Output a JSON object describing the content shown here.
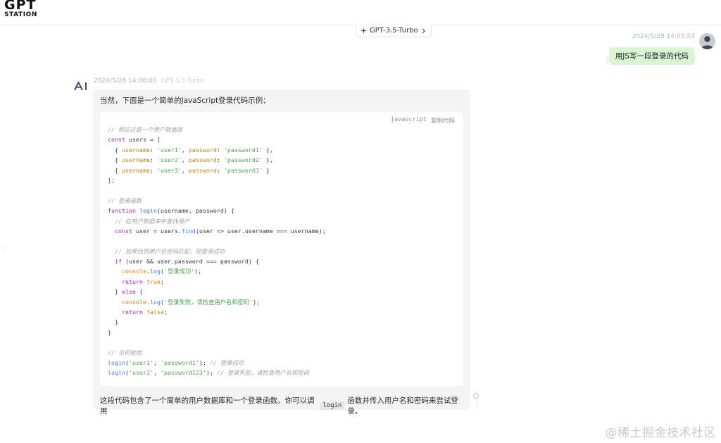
{
  "header": {
    "logo_line1": "GPT",
    "logo_line2": "STATION",
    "model_pill_label": "GPT-3.5-Turbo"
  },
  "user_message": {
    "timestamp": "2024/5/28 14:05:54",
    "text": "用JS写一段登录的代码"
  },
  "ai_message": {
    "avatar_text": "AI",
    "timestamp": "2024/5/28 14:06:00",
    "model": "GPT-3.5-Turbo",
    "intro": "当然，下面是一个简单的JavaScript登录代码示例：",
    "code": {
      "language": "javascript",
      "copy_label": "复制代码",
      "lines": [
        [
          {
            "t": "cm",
            "v": "// 假设这是一个用户数据库"
          }
        ],
        [
          {
            "t": "kw",
            "v": "const"
          },
          {
            "t": "plain",
            "v": " users = ["
          }
        ],
        [
          {
            "t": "plain",
            "v": "  { "
          },
          {
            "t": "prop",
            "v": "username"
          },
          {
            "t": "plain",
            "v": ": "
          },
          {
            "t": "str",
            "v": "'user1'"
          },
          {
            "t": "plain",
            "v": ", "
          },
          {
            "t": "prop",
            "v": "password"
          },
          {
            "t": "plain",
            "v": ": "
          },
          {
            "t": "str",
            "v": "'password1'"
          },
          {
            "t": "plain",
            "v": " },"
          }
        ],
        [
          {
            "t": "plain",
            "v": "  { "
          },
          {
            "t": "prop",
            "v": "username"
          },
          {
            "t": "plain",
            "v": ": "
          },
          {
            "t": "str",
            "v": "'user2'"
          },
          {
            "t": "plain",
            "v": ", "
          },
          {
            "t": "prop",
            "v": "password"
          },
          {
            "t": "plain",
            "v": ": "
          },
          {
            "t": "str",
            "v": "'password2'"
          },
          {
            "t": "plain",
            "v": " },"
          }
        ],
        [
          {
            "t": "plain",
            "v": "  { "
          },
          {
            "t": "prop",
            "v": "username"
          },
          {
            "t": "plain",
            "v": ": "
          },
          {
            "t": "str",
            "v": "'user3'"
          },
          {
            "t": "plain",
            "v": ", "
          },
          {
            "t": "prop",
            "v": "password"
          },
          {
            "t": "plain",
            "v": ": "
          },
          {
            "t": "str",
            "v": "'password3'"
          },
          {
            "t": "plain",
            "v": " }"
          }
        ],
        [
          {
            "t": "plain",
            "v": "];"
          }
        ],
        [
          {
            "t": "plain",
            "v": ""
          }
        ],
        [
          {
            "t": "cm",
            "v": "// 登录函数"
          }
        ],
        [
          {
            "t": "kw",
            "v": "function"
          },
          {
            "t": "plain",
            "v": " "
          },
          {
            "t": "fn",
            "v": "login"
          },
          {
            "t": "plain",
            "v": "(username, password) {"
          }
        ],
        [
          {
            "t": "plain",
            "v": "  "
          },
          {
            "t": "cm",
            "v": "// 在用户数据库中查找用户"
          }
        ],
        [
          {
            "t": "plain",
            "v": "  "
          },
          {
            "t": "kw",
            "v": "const"
          },
          {
            "t": "plain",
            "v": " user = users."
          },
          {
            "t": "fn",
            "v": "find"
          },
          {
            "t": "plain",
            "v": "(user => user.username === username);"
          }
        ],
        [
          {
            "t": "plain",
            "v": ""
          }
        ],
        [
          {
            "t": "plain",
            "v": "  "
          },
          {
            "t": "cm",
            "v": "// 如果找到用户且密码匹配，则登录成功"
          }
        ],
        [
          {
            "t": "plain",
            "v": "  "
          },
          {
            "t": "kw",
            "v": "if"
          },
          {
            "t": "plain",
            "v": " (user && user.password === password) {"
          }
        ],
        [
          {
            "t": "plain",
            "v": "    "
          },
          {
            "t": "prop",
            "v": "console"
          },
          {
            "t": "plain",
            "v": "."
          },
          {
            "t": "fn",
            "v": "log"
          },
          {
            "t": "plain",
            "v": "("
          },
          {
            "t": "str",
            "v": "'登录成功'"
          },
          {
            "t": "plain",
            "v": ");"
          }
        ],
        [
          {
            "t": "plain",
            "v": "    "
          },
          {
            "t": "kw",
            "v": "return"
          },
          {
            "t": "plain",
            "v": " "
          },
          {
            "t": "prop",
            "v": "true"
          },
          {
            "t": "plain",
            "v": ";"
          }
        ],
        [
          {
            "t": "plain",
            "v": "  } "
          },
          {
            "t": "kw",
            "v": "else"
          },
          {
            "t": "plain",
            "v": " {"
          }
        ],
        [
          {
            "t": "plain",
            "v": "    "
          },
          {
            "t": "prop",
            "v": "console"
          },
          {
            "t": "plain",
            "v": "."
          },
          {
            "t": "fn",
            "v": "log"
          },
          {
            "t": "plain",
            "v": "("
          },
          {
            "t": "str",
            "v": "'登录失败，请检查用户名和密码'"
          },
          {
            "t": "plain",
            "v": ");"
          }
        ],
        [
          {
            "t": "plain",
            "v": "    "
          },
          {
            "t": "kw",
            "v": "return"
          },
          {
            "t": "plain",
            "v": " "
          },
          {
            "t": "prop",
            "v": "false"
          },
          {
            "t": "plain",
            "v": ";"
          }
        ],
        [
          {
            "t": "plain",
            "v": "  }"
          }
        ],
        [
          {
            "t": "plain",
            "v": "}"
          }
        ],
        [
          {
            "t": "plain",
            "v": ""
          }
        ],
        [
          {
            "t": "cm",
            "v": "// 示例使用"
          }
        ],
        [
          {
            "t": "fn",
            "v": "login"
          },
          {
            "t": "plain",
            "v": "("
          },
          {
            "t": "str",
            "v": "'user1'"
          },
          {
            "t": "plain",
            "v": ", "
          },
          {
            "t": "str",
            "v": "'password1'"
          },
          {
            "t": "plain",
            "v": "); "
          },
          {
            "t": "cm",
            "v": "// 登录成功"
          }
        ],
        [
          {
            "t": "fn",
            "v": "login"
          },
          {
            "t": "plain",
            "v": "("
          },
          {
            "t": "str",
            "v": "'user2'"
          },
          {
            "t": "plain",
            "v": ", "
          },
          {
            "t": "str",
            "v": "'password123'"
          },
          {
            "t": "plain",
            "v": "); "
          },
          {
            "t": "cm",
            "v": "// 登录失败，请检查用户名和密码"
          }
        ]
      ]
    },
    "outro_before": "这段代码包含了一个简单的用户数据库和一个登录函数。你可以调用",
    "outro_code": "login",
    "outro_after": "函数并传入用户名和密码来尝试登录。"
  },
  "watermark": "@稀土掘金技术社区",
  "colors": {
    "user_bubble": "#d9f5d2",
    "ai_bubble": "#f4f4f5",
    "code_keyword": "#a626a4",
    "code_function": "#4078f2",
    "code_string": "#50a14f",
    "code_comment": "#a0a1a7"
  }
}
